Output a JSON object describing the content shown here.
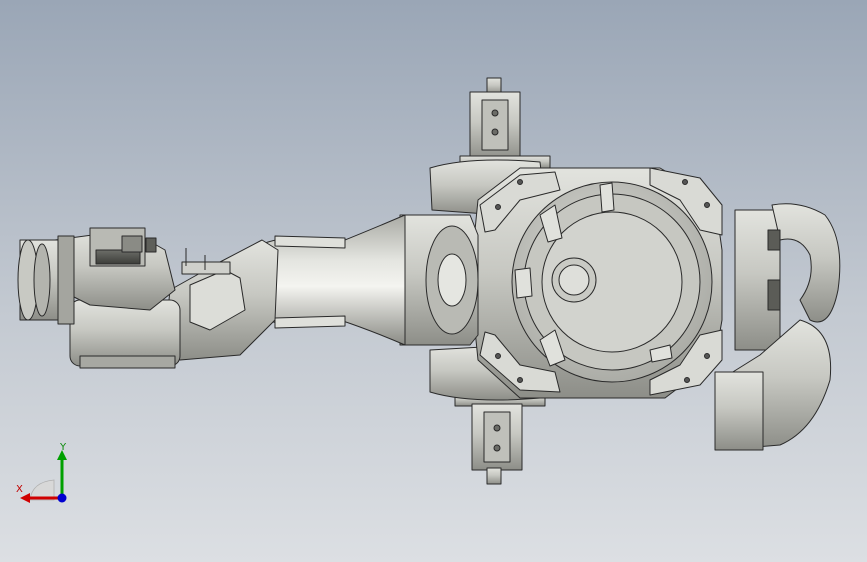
{
  "viewport": {
    "background_top": "#9aa6b6",
    "background_bottom": "#dcdfe3",
    "model_color": "#c9cac4",
    "edge_color": "#2a2a2a"
  },
  "triad": {
    "x_label": "X",
    "y_label": "Y",
    "x_color": "#d00000",
    "y_color": "#00a000",
    "z_color": "#0000d0"
  }
}
